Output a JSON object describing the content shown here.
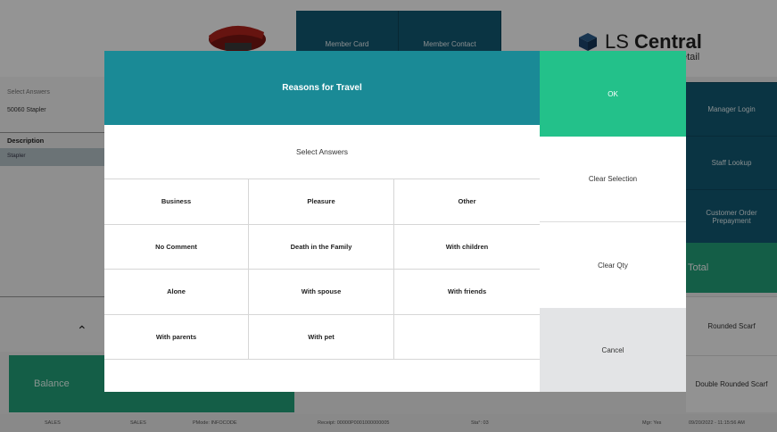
{
  "background": {
    "top_tiles": [
      "Member Card",
      "Member Contact"
    ],
    "logo": {
      "brand": "LS",
      "name": "Central",
      "sub": "etail"
    },
    "left_panel": {
      "input_placeholder": "Select Answers",
      "item": "50060 Stapler",
      "column_header": "Description",
      "row": "Stapler",
      "balance": "Balance"
    },
    "right_column": {
      "manager_login": "Manager Login",
      "staff_lookup": "Staff Lookup",
      "customer_order": "Customer Order Prepayment",
      "total": "Total",
      "rounded_scarf": "Rounded Scarf",
      "double_rounded_scarf": "Double Rounded Scarf"
    },
    "status_bar": {
      "s1": "SALES",
      "s2": "SALES",
      "pmode": "PMode: INFOCODE",
      "receipt": "Receipt: 00000P0001000000005",
      "sta": "Sta°: 03",
      "mgr": "Mgr: Yes",
      "datetime": "09/20/2022 - 11:15:56 AM"
    }
  },
  "dialog": {
    "title": "Reasons for Travel",
    "subtitle": "Select Answers",
    "answers": [
      "Business",
      "Pleasure",
      "Other",
      "No Comment",
      "Death in the Family",
      "With children",
      "Alone",
      "With spouse",
      "With friends",
      "With parents",
      "With pet",
      ""
    ],
    "buttons": {
      "ok": "OK",
      "clear_selection": "Clear Selection",
      "clear_qty": "Clear Qty",
      "cancel": "Cancel"
    }
  },
  "colors": {
    "title_bar": "#1a8a96",
    "ok": "#23c18a",
    "tile_dark": "#125a74",
    "balance": "#24a27a"
  }
}
